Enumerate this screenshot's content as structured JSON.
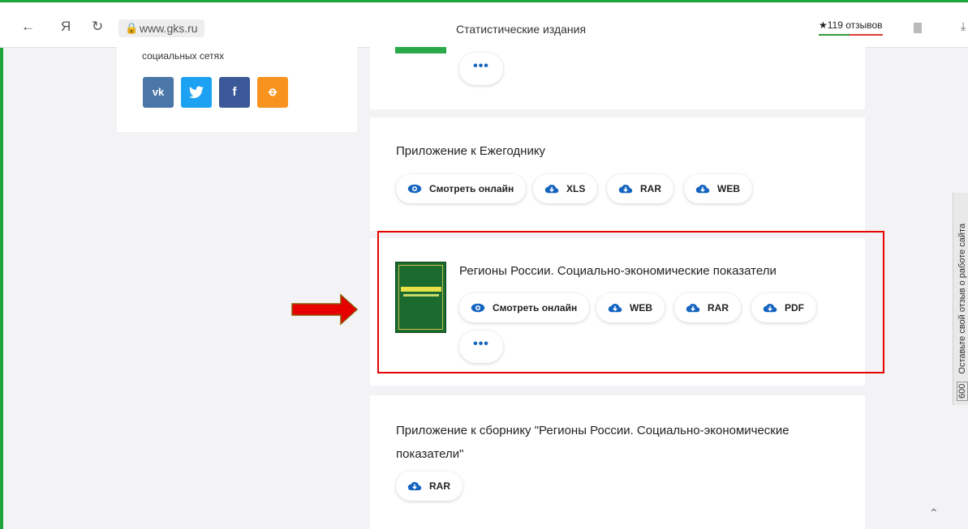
{
  "browser": {
    "url": "www.gks.ru",
    "title": "Статистические издания",
    "reviews": "★119 отзывов"
  },
  "social": {
    "label": "социальных сетях",
    "buttons": [
      {
        "name": "vk",
        "glyph": "vk",
        "color": "#4a76a8"
      },
      {
        "name": "twitter",
        "glyph": "t",
        "color": "#1da1f2"
      },
      {
        "name": "facebook",
        "glyph": "f",
        "color": "#3b5998"
      },
      {
        "name": "odnoklassniki",
        "glyph": "ok",
        "color": "#f7931e"
      }
    ]
  },
  "cards": {
    "top": {
      "more": "•••"
    },
    "yearbook_appendix": {
      "title": "Приложение к Ежегоднику",
      "buttons": [
        "Смотреть онлайн",
        "XLS",
        "RAR",
        "WEB"
      ]
    },
    "regions": {
      "title": "Регионы России. Социально-экономические показатели",
      "buttons": [
        "Смотреть онлайн",
        "WEB",
        "RAR",
        "PDF"
      ],
      "more": "•••"
    },
    "regions_appendix": {
      "title_line1": "Приложение к сборнику \"Регионы России. Социально-экономические",
      "title_line2": "показатели\"",
      "buttons": [
        "RAR"
      ]
    }
  },
  "feedback": {
    "text": "Оставьте свой отзыв о работе сайта",
    "badge": "600"
  },
  "colors": {
    "accent": "#1565c0",
    "highlight": "#e60000",
    "arrow": "#e60000",
    "frame": "#1fa33c"
  }
}
